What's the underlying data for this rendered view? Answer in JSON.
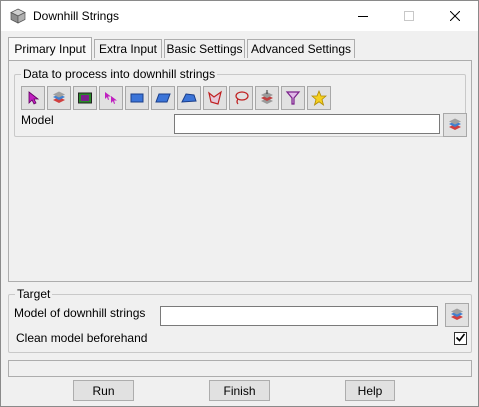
{
  "window": {
    "title": "Downhill Strings"
  },
  "titlebar": {
    "minimize_icon": "minimize-icon",
    "maximize_icon": "maximize-icon",
    "close_icon": "close-icon"
  },
  "tabs": [
    {
      "label": "Primary Input",
      "active": true
    },
    {
      "label": "Extra Input",
      "active": false
    },
    {
      "label": "Basic Settings",
      "active": false
    },
    {
      "label": "Advanced Settings",
      "active": false
    }
  ],
  "data_group": {
    "label": "Data to process into downhill strings",
    "icons": [
      "pointer-select-icon",
      "model-layers-icon",
      "view-display-icon",
      "multi-pick-icon",
      "rectangle-icon",
      "parallelogram-icon",
      "polygon-icon",
      "fence-icon",
      "lasso-icon",
      "layers-stack-icon",
      "filter-funnel-icon",
      "favourites-star-icon"
    ],
    "model_label": "Model",
    "model_value": ""
  },
  "target_group": {
    "label": "Target",
    "model_label": "Model of downhill strings",
    "model_value": "",
    "clean_label": "Clean model beforehand",
    "clean_checked": true
  },
  "buttons": {
    "run": "Run",
    "finish": "Finish",
    "help": "Help"
  }
}
